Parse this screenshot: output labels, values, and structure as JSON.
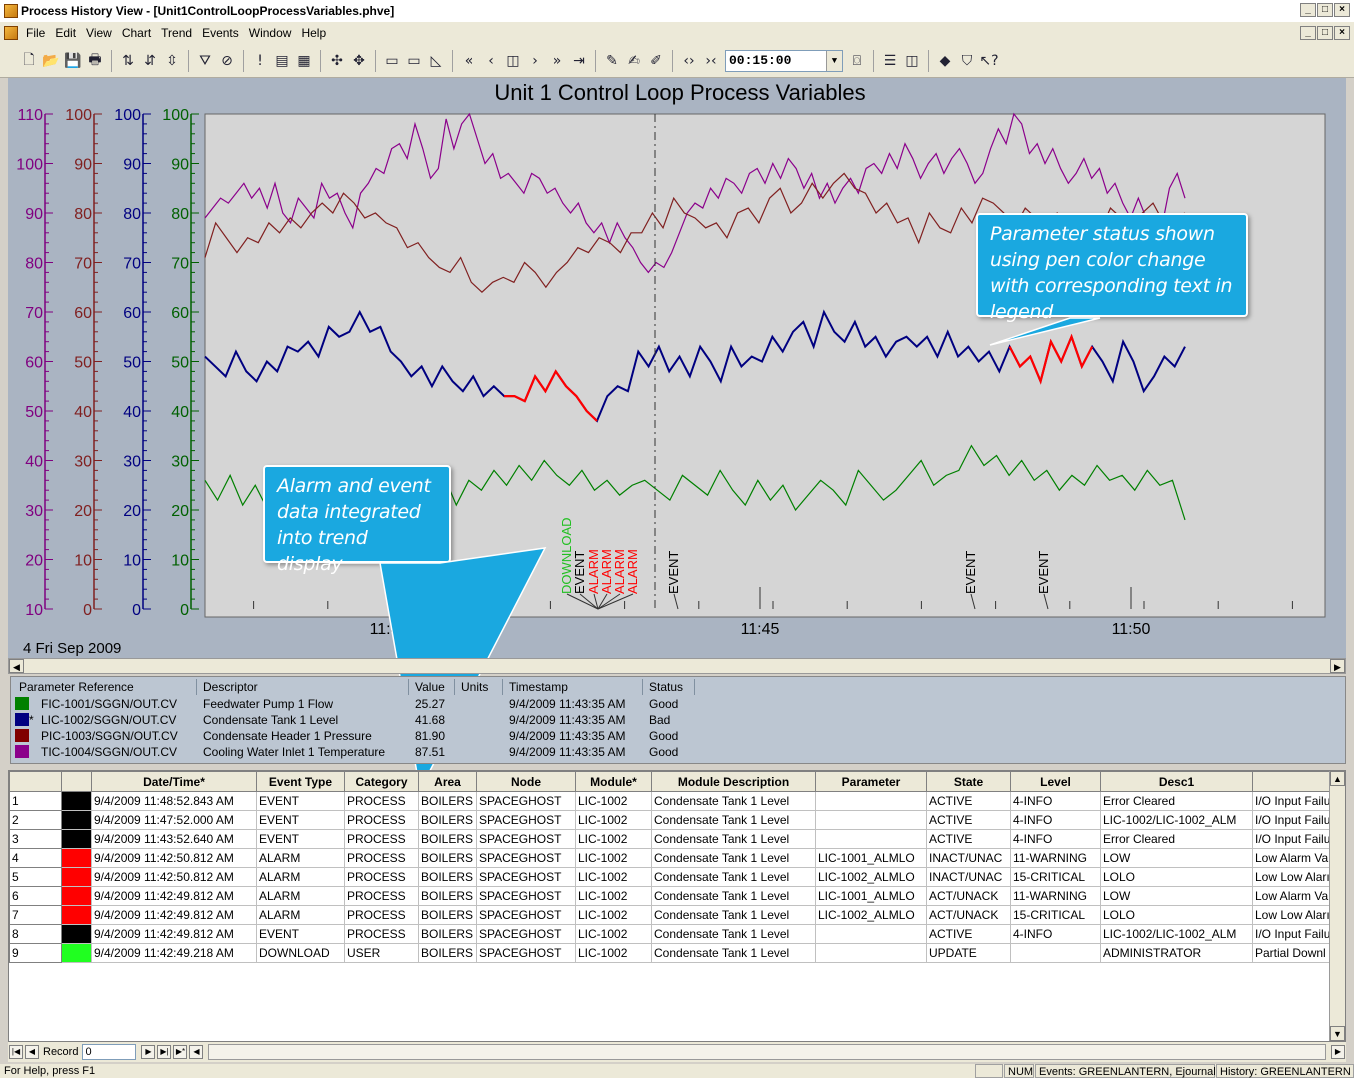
{
  "window": {
    "title": "Process History View - [Unit1ControlLoopProcessVariables.phve]",
    "controls": [
      "_",
      "□",
      "×"
    ]
  },
  "menu": [
    "File",
    "Edit",
    "View",
    "Chart",
    "Trend",
    "Events",
    "Window",
    "Help"
  ],
  "toolbar": {
    "time_span": "00:15:00"
  },
  "chart": {
    "title": "Unit 1 Control Loop Process Variables",
    "date_label": "4 Fri Sep 2009"
  },
  "chart_data": {
    "type": "line",
    "title": "Unit 1 Control Loop Process Variables",
    "x_tick_labels": [
      "11:40",
      "11:45",
      "11:50"
    ],
    "x_range_minutes": [
      11.37,
      11.852
    ],
    "axes": [
      {
        "color": "#800080",
        "min": 10,
        "max": 110,
        "ticks": [
          "10",
          "20",
          "30",
          "40",
          "50",
          "60",
          "70",
          "80",
          "90",
          "100",
          "110"
        ]
      },
      {
        "color": "#802020",
        "min": 0,
        "max": 100,
        "ticks": [
          "0",
          "10",
          "20",
          "30",
          "40",
          "50",
          "60",
          "70",
          "80",
          "90",
          "100"
        ]
      },
      {
        "color": "#000080",
        "min": 0,
        "max": 100,
        "ticks": [
          "0",
          "10",
          "20",
          "30",
          "40",
          "50",
          "60",
          "70",
          "80",
          "90",
          "100"
        ]
      },
      {
        "color": "#006000",
        "min": 0,
        "max": 100,
        "ticks": [
          "0",
          "10",
          "20",
          "30",
          "40",
          "50",
          "60",
          "70",
          "80",
          "90",
          "100"
        ]
      }
    ],
    "cursor_time": "11:43:35",
    "series": [
      {
        "name": "TIC-1004/SGGN/OUT.CV",
        "color": "#8b008b",
        "values": [
          89,
          91,
          93,
          92,
          94,
          96,
          93,
          95,
          91,
          96,
          90,
          88,
          93,
          91,
          89,
          96,
          93,
          94,
          90,
          87,
          94,
          96,
          99,
          98,
          103,
          104,
          101,
          108,
          103,
          97,
          99,
          109,
          103,
          108,
          110,
          105,
          100,
          102,
          97,
          98,
          96,
          94,
          98,
          97,
          94,
          95,
          92,
          90,
          92,
          88,
          86,
          88,
          84,
          88,
          85,
          83,
          80,
          78,
          80,
          79,
          82,
          86,
          90,
          92,
          91,
          95,
          93,
          97,
          96,
          94,
          98,
          99,
          96,
          100,
          97,
          101,
          99,
          95,
          98,
          93,
          96,
          92,
          95,
          97,
          94,
          99,
          100,
          98,
          102,
          99,
          104,
          101,
          97,
          100,
          102,
          98,
          101,
          103,
          100,
          96,
          98,
          103,
          107,
          104,
          110,
          108,
          102,
          104,
          100,
          103,
          99,
          96,
          98,
          101,
          97,
          99,
          94,
          96,
          92,
          89,
          93,
          89,
          86,
          87,
          95,
          98,
          93
        ]
      },
      {
        "name": "PIC-1003/SGGN/OUT.CV",
        "color": "#802020",
        "values": [
          71,
          78,
          75,
          72,
          75,
          74,
          78,
          76,
          79,
          77,
          80,
          82,
          80,
          84,
          82,
          79,
          80,
          78,
          77,
          73,
          74,
          71,
          69,
          68,
          71,
          66,
          64,
          66,
          67,
          66,
          70,
          68,
          65,
          68,
          70,
          73,
          72,
          75,
          74,
          72,
          76,
          76,
          80,
          77,
          83,
          80,
          79,
          77,
          78,
          75,
          80,
          81,
          78,
          83,
          85,
          80,
          82,
          86,
          83,
          86,
          88,
          85,
          84,
          80,
          82,
          78,
          79,
          74,
          80,
          77,
          76,
          81,
          78,
          83,
          82,
          80,
          77,
          81,
          79,
          76,
          80,
          78,
          74,
          77,
          76,
          81,
          79,
          76,
          80,
          82,
          78,
          79,
          80
        ]
      },
      {
        "name": "LIC-1002/SGGN/OUT.CV",
        "color": "#000080",
        "values": [
          51,
          49,
          47,
          52,
          48,
          46,
          50,
          48,
          53,
          52,
          54,
          51,
          57,
          55,
          56,
          60,
          56,
          57,
          52,
          50,
          47,
          49,
          45,
          49,
          46,
          44,
          47,
          43,
          45,
          43,
          43,
          42,
          47,
          44,
          48,
          45,
          43,
          40,
          38,
          43,
          45,
          44,
          52,
          49,
          53,
          48,
          51,
          47,
          53,
          50,
          46,
          53,
          49,
          51,
          50,
          55,
          52,
          56,
          58,
          53,
          60,
          56,
          54,
          58,
          53,
          55,
          51,
          54,
          55,
          53,
          55,
          51,
          56,
          51,
          53,
          50,
          52,
          48,
          53,
          49,
          51,
          46,
          54,
          50,
          55,
          49,
          53,
          50,
          46,
          54,
          50,
          44,
          47,
          51,
          49,
          53
        ]
      },
      {
        "name": "FIC-1001/SGGN/OUT.CV",
        "color": "#008000",
        "values": [
          26,
          22,
          27,
          21,
          25,
          20,
          24,
          19,
          27,
          24,
          21,
          23,
          18,
          22,
          17,
          23,
          19,
          25,
          22,
          27,
          21,
          26,
          24,
          28,
          25,
          29,
          26,
          30,
          27,
          25,
          28,
          24,
          26,
          23,
          25,
          26,
          24,
          22,
          27,
          25,
          23,
          28,
          24,
          21,
          26,
          22,
          25,
          20,
          23,
          26,
          24,
          21,
          28,
          25,
          22,
          24,
          27,
          30,
          25,
          27,
          28,
          33,
          29,
          31,
          27,
          30,
          26,
          28,
          24,
          27,
          25,
          29,
          26,
          27,
          24,
          28,
          25,
          26,
          18
        ]
      }
    ],
    "red_segments": [
      {
        "series": "LIC-1002/SGGN/OUT.CV",
        "from": 29,
        "to": 38
      },
      {
        "series": "LIC-1002/SGGN/OUT.CV",
        "from": 78,
        "to": 86
      }
    ],
    "event_markers": [
      {
        "label": "DOWNLOAD",
        "color": "#20c020"
      },
      {
        "label": "EVENT",
        "color": "#000000"
      },
      {
        "label": "ALARM",
        "color": "#ff0000"
      },
      {
        "label": "ALARM",
        "color": "#ff0000"
      },
      {
        "label": "ALARM",
        "color": "#ff0000"
      },
      {
        "label": "ALARM",
        "color": "#ff0000"
      },
      {
        "label": "EVENT",
        "color": "#000000"
      },
      {
        "label": "EVENT",
        "color": "#000000"
      },
      {
        "label": "EVENT",
        "color": "#000000"
      }
    ]
  },
  "callouts": {
    "status": "Parameter status shown using pen color change with corresponding text in legend",
    "alarm": "Alarm and event data integrated into trend display"
  },
  "legend": {
    "headers": [
      "Parameter Reference",
      "Descriptor",
      "Value",
      "Units",
      "Timestamp",
      "Status"
    ],
    "rows": [
      {
        "color": "#008000",
        "ref": "FIC-1001/SGGN/OUT.CV",
        "desc": "Feedwater Pump 1 Flow",
        "value": "25.27",
        "units": "",
        "timestamp": "9/4/2009 11:43:35 AM",
        "status": "Good",
        "marker": ""
      },
      {
        "color": "#000080",
        "ref": "LIC-1002/SGGN/OUT.CV",
        "desc": "Condensate Tank 1 Level",
        "value": "41.68",
        "units": "",
        "timestamp": "9/4/2009 11:43:35 AM",
        "status": "Bad",
        "marker": "*"
      },
      {
        "color": "#800000",
        "ref": "PIC-1003/SGGN/OUT.CV",
        "desc": "Condensate Header 1 Pressure",
        "value": "81.90",
        "units": "",
        "timestamp": "9/4/2009 11:43:35 AM",
        "status": "Good",
        "marker": ""
      },
      {
        "color": "#8b008b",
        "ref": "TIC-1004/SGGN/OUT.CV",
        "desc": "Cooling Water Inlet 1 Temperature",
        "value": "87.51",
        "units": "",
        "timestamp": "9/4/2009 11:43:35 AM",
        "status": "Good",
        "marker": ""
      }
    ]
  },
  "events": {
    "headers": [
      "",
      "",
      "Date/Time*",
      "Event Type",
      "Category",
      "Area",
      "Node",
      "Module*",
      "Module Description",
      "Parameter",
      "State",
      "Level",
      "Desc1",
      ""
    ],
    "rows": [
      {
        "n": "1",
        "color": "#000000",
        "dt": "9/4/2009 11:48:52.843 AM",
        "type": "EVENT",
        "cat": "PROCESS",
        "area": "BOILERS",
        "node": "SPACEGHOST",
        "module": "LIC-1002",
        "mdesc": "Condensate Tank 1 Level",
        "param": "",
        "state": "ACTIVE",
        "level": "4-INFO",
        "desc1": "Error Cleared",
        "desc2": "I/O Input Failu"
      },
      {
        "n": "2",
        "color": "#000000",
        "dt": "9/4/2009 11:47:52.000 AM",
        "type": "EVENT",
        "cat": "PROCESS",
        "area": "BOILERS",
        "node": "SPACEGHOST",
        "module": "LIC-1002",
        "mdesc": "Condensate Tank 1 Level",
        "param": "",
        "state": "ACTIVE",
        "level": "4-INFO",
        "desc1": "LIC-1002/LIC-1002_ALM",
        "desc2": "I/O Input Failu"
      },
      {
        "n": "3",
        "color": "#000000",
        "dt": "9/4/2009 11:43:52.640 AM",
        "type": "EVENT",
        "cat": "PROCESS",
        "area": "BOILERS",
        "node": "SPACEGHOST",
        "module": "LIC-1002",
        "mdesc": "Condensate Tank 1 Level",
        "param": "",
        "state": "ACTIVE",
        "level": "4-INFO",
        "desc1": "Error Cleared",
        "desc2": "I/O Input Failu"
      },
      {
        "n": "4",
        "color": "#ff0000",
        "dt": "9/4/2009 11:42:50.812 AM",
        "type": "ALARM",
        "cat": "PROCESS",
        "area": "BOILERS",
        "node": "SPACEGHOST",
        "module": "LIC-1002",
        "mdesc": "Condensate Tank 1 Level",
        "param": "LIC-1001_ALMLO",
        "state": "INACT/UNAC",
        "level": "11-WARNING",
        "desc1": "LOW",
        "desc2": "Low Alarm Va"
      },
      {
        "n": "5",
        "color": "#ff0000",
        "dt": "9/4/2009 11:42:50.812 AM",
        "type": "ALARM",
        "cat": "PROCESS",
        "area": "BOILERS",
        "node": "SPACEGHOST",
        "module": "LIC-1002",
        "mdesc": "Condensate Tank 1 Level",
        "param": "LIC-1002_ALMLO",
        "state": "INACT/UNAC",
        "level": "15-CRITICAL",
        "desc1": "LOLO",
        "desc2": "Low Low Aları"
      },
      {
        "n": "6",
        "color": "#ff0000",
        "dt": "9/4/2009 11:42:49.812 AM",
        "type": "ALARM",
        "cat": "PROCESS",
        "area": "BOILERS",
        "node": "SPACEGHOST",
        "module": "LIC-1002",
        "mdesc": "Condensate Tank 1 Level",
        "param": "LIC-1001_ALMLO",
        "state": "ACT/UNACK",
        "level": "11-WARNING",
        "desc1": "LOW",
        "desc2": "Low Alarm Va"
      },
      {
        "n": "7",
        "color": "#ff0000",
        "dt": "9/4/2009 11:42:49.812 AM",
        "type": "ALARM",
        "cat": "PROCESS",
        "area": "BOILERS",
        "node": "SPACEGHOST",
        "module": "LIC-1002",
        "mdesc": "Condensate Tank 1 Level",
        "param": "LIC-1002_ALMLO",
        "state": "ACT/UNACK",
        "level": "15-CRITICAL",
        "desc1": "LOLO",
        "desc2": "Low Low Aları"
      },
      {
        "n": "8",
        "color": "#000000",
        "dt": "9/4/2009 11:42:49.812 AM",
        "type": "EVENT",
        "cat": "PROCESS",
        "area": "BOILERS",
        "node": "SPACEGHOST",
        "module": "LIC-1002",
        "mdesc": "Condensate Tank 1 Level",
        "param": "",
        "state": "ACTIVE",
        "level": "4-INFO",
        "desc1": "LIC-1002/LIC-1002_ALM",
        "desc2": "I/O Input Failu"
      },
      {
        "n": "9",
        "color": "#20ff20",
        "dt": "9/4/2009 11:42:49.218 AM",
        "type": "DOWNLOAD",
        "cat": "USER",
        "area": "BOILERS",
        "node": "SPACEGHOST",
        "module": "LIC-1002",
        "mdesc": "Condensate Tank 1 Level",
        "param": "",
        "state": "UPDATE",
        "level": "",
        "desc1": "ADMINISTRATOR",
        "desc2": "Partial Downl"
      }
    ]
  },
  "nav": {
    "record_label": "Record",
    "record_value": "0"
  },
  "status": {
    "help": "For Help, press F1",
    "num": "NUM",
    "events": "Events: GREENLANTERN, Ejournal",
    "history": "History: GREENLANTERN"
  }
}
